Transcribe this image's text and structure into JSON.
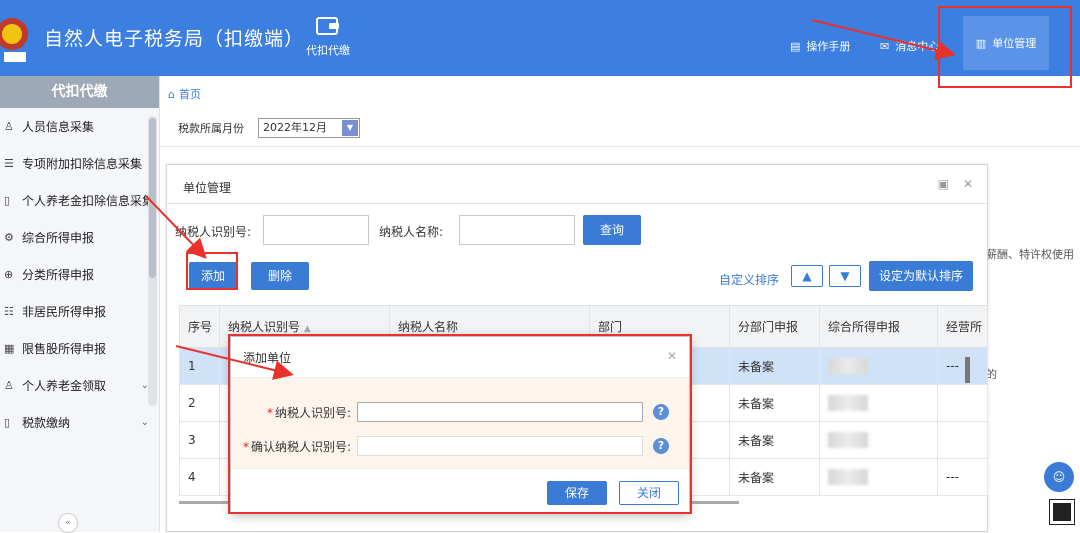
{
  "header": {
    "app_title": "自然人电子税务局（扣缴端）",
    "nav_item": "代扣代缴",
    "links": {
      "manual": "操作手册",
      "message": "消息中心",
      "unit_mgmt": "单位管理"
    },
    "bg_color": "#3d7fe0"
  },
  "sidebar": {
    "title": "代扣代缴",
    "items": [
      {
        "label": "人员信息采集",
        "icon": "person-icon"
      },
      {
        "label": "专项附加扣除信息采集",
        "icon": "list-icon"
      },
      {
        "label": "个人养老金扣除信息采集",
        "icon": "document-icon"
      },
      {
        "label": "综合所得申报",
        "icon": "gear-icon"
      },
      {
        "label": "分类所得申报",
        "icon": "grid-icon"
      },
      {
        "label": "非居民所得申报",
        "icon": "globe-icon"
      },
      {
        "label": "限售股所得申报",
        "icon": "chart-icon"
      },
      {
        "label": "个人养老金领取",
        "icon": "person-icon",
        "expandable": true
      },
      {
        "label": "税款缴纳",
        "icon": "document-icon",
        "expandable": true
      }
    ]
  },
  "breadcrumb": {
    "home": "首页"
  },
  "period": {
    "label": "税款所属月份",
    "value": "2022年12月"
  },
  "background_text": "薪酬、特许权使用",
  "background_text_2": "的",
  "panel": {
    "title": "单位管理",
    "search": {
      "tax_id_label": "纳税人识别号:",
      "tax_id_value": "",
      "name_label": "纳税人名称:",
      "name_value": "",
      "query_button": "查询"
    },
    "toolbar": {
      "add_button": "添加",
      "delete_button": "删除",
      "custom_sort": "自定义排序",
      "set_default_sort": "设定为默认排序"
    },
    "table": {
      "columns": [
        "序号",
        "纳税人识别号",
        "纳税人名称",
        "部门",
        "分部门申报",
        "综合所得申报",
        "经营所"
      ],
      "rows": [
        {
          "no": "1",
          "dept_report": "未备案",
          "extra": "---"
        },
        {
          "no": "2",
          "dept_report": "未备案",
          "extra": ""
        },
        {
          "no": "3",
          "dept_report": "未备案",
          "extra": ""
        },
        {
          "no": "4",
          "dept_report": "未备案",
          "extra": "---"
        }
      ]
    }
  },
  "dialog": {
    "title": "添加单位",
    "fields": [
      {
        "label": "纳税人识别号:",
        "value": "",
        "required": true
      },
      {
        "label": "确认纳税人识别号:",
        "value": "",
        "required": true
      }
    ],
    "help_glyph": "?",
    "save_button": "保存",
    "close_button": "关闭"
  },
  "accent": {
    "annotation_red": "#e8322b",
    "primary_blue": "#3a7bd5"
  }
}
